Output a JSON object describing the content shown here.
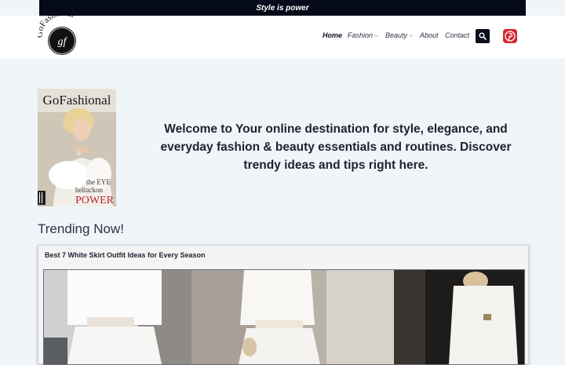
{
  "topbar": {
    "tagline": "Style is power"
  },
  "logo": {
    "wordmark": "GoFashional",
    "monogram": "gf"
  },
  "nav": {
    "items": [
      {
        "label": "Home",
        "active": true,
        "dropdown": false
      },
      {
        "label": "Fashion",
        "active": false,
        "dropdown": true
      },
      {
        "label": "Beauty",
        "active": false,
        "dropdown": true
      },
      {
        "label": "About",
        "active": false,
        "dropdown": false
      },
      {
        "label": "Contact",
        "active": false,
        "dropdown": false
      }
    ],
    "chevron_glyph": "⌵",
    "search_icon": "search-icon",
    "social_icon": "pinterest-icon"
  },
  "hero": {
    "cover": {
      "masthead": "GoFashional",
      "headline_small": "the EYE",
      "headline_mid": "heltackon",
      "headline_big": "POWER"
    },
    "welcome_text": "Welcome to Your online destination for style, elegance, and everyday fashion & beauty essentials and routines. Discover trendy ideas and tips right here."
  },
  "trending": {
    "heading": "Trending Now!",
    "card_title": "Best 7 White Skirt Outfit Ideas for Every Season"
  },
  "colors": {
    "topbar": "#050a18",
    "page_bg": "#f0f5f9",
    "pinterest": "#d5262e",
    "search_bg": "#0a0f1d"
  }
}
